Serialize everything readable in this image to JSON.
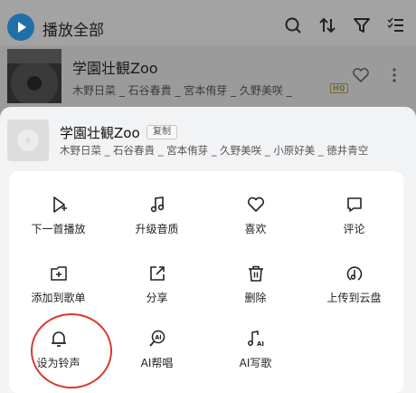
{
  "header": {
    "play_all_label": "播放全部"
  },
  "background_song": {
    "title": "学園壮観Zoo",
    "artists": "木野日菜 _ 石谷春貴 _ 宮本侑芽 _ 久野美咲 _",
    "quality_badge": "HQ"
  },
  "sheet": {
    "song_title": "学園壮観Zoo",
    "copy_label": "复制",
    "artists": "木野日菜 _ 石谷春貴 _ 宮本侑芽 _ 久野美咲 _ 小原好美 _ 徳井青空"
  },
  "actions": [
    {
      "label": "下一首播放",
      "icon": "play-next-icon"
    },
    {
      "label": "升级音质",
      "icon": "music-note-icon"
    },
    {
      "label": "喜欢",
      "icon": "heart-icon"
    },
    {
      "label": "评论",
      "icon": "comment-icon"
    },
    {
      "label": "添加到歌单",
      "icon": "folder-add-icon"
    },
    {
      "label": "分享",
      "icon": "share-icon"
    },
    {
      "label": "删除",
      "icon": "trash-icon"
    },
    {
      "label": "上传到云盘",
      "icon": "cloud-upload-icon"
    },
    {
      "label": "设为铃声",
      "icon": "bell-icon"
    },
    {
      "label": "AI帮唱",
      "icon": "ai-sing-icon"
    },
    {
      "label": "AI写歌",
      "icon": "ai-write-icon"
    }
  ],
  "colors": {
    "accent": "#1f6fa8",
    "annotation": "#d93a2c"
  }
}
